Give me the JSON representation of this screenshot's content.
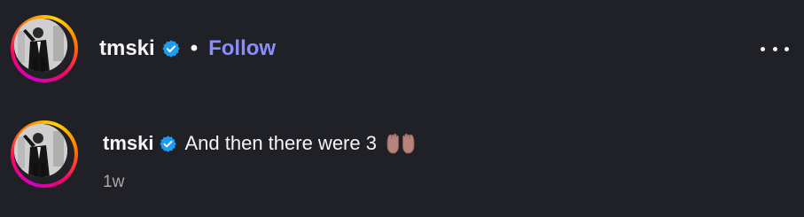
{
  "post_header": {
    "username": "tmski",
    "separator": "•",
    "follow_label": "Follow"
  },
  "comment": {
    "username": "tmski",
    "text": "And then there were 3",
    "emoji": "palms-up-together-emoji",
    "timestamp": "1w"
  },
  "icons": {
    "verified": "verified-badge-icon",
    "more": "more-options-icon"
  },
  "colors": {
    "background": "#202027",
    "follow_link": "#8a8dff",
    "verified_badge": "#1d9bf0",
    "timestamp": "#a8a8a8"
  }
}
